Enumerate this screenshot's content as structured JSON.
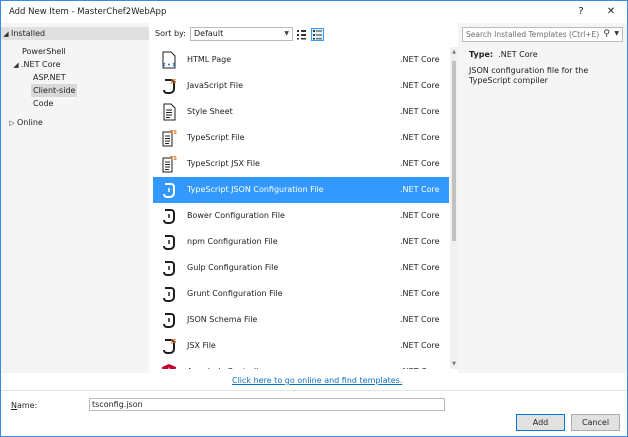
{
  "window": {
    "title": "Add New Item - MasterChef2WebApp",
    "help_label": "?",
    "close_label": "✕"
  },
  "tree": {
    "installed": "Installed",
    "items": [
      {
        "label": "PowerShell"
      },
      {
        "label": ".NET Core"
      },
      {
        "label": "ASP.NET"
      },
      {
        "label": "Client-side"
      },
      {
        "label": "Code"
      }
    ],
    "online": "Online"
  },
  "sort": {
    "label": "Sort by:",
    "value": "Default"
  },
  "templates": [
    {
      "name": "HTML Page",
      "category": ".NET Core",
      "icon": "html-page-icon"
    },
    {
      "name": "JavaScript File",
      "category": ".NET Core",
      "icon": "javascript-file-icon"
    },
    {
      "name": "Style Sheet",
      "category": ".NET Core",
      "icon": "style-sheet-icon"
    },
    {
      "name": "TypeScript File",
      "category": ".NET Core",
      "icon": "typescript-file-icon"
    },
    {
      "name": "TypeScript JSX File",
      "category": ".NET Core",
      "icon": "typescript-jsx-file-icon"
    },
    {
      "name": "TypeScript JSON Configuration File",
      "category": ".NET Core",
      "icon": "json-config-icon",
      "selected": true
    },
    {
      "name": "Bower Configuration File",
      "category": ".NET Core",
      "icon": "json-config-icon"
    },
    {
      "name": "npm Configuration File",
      "category": ".NET Core",
      "icon": "json-config-icon"
    },
    {
      "name": "Gulp Configuration File",
      "category": ".NET Core",
      "icon": "json-config-icon"
    },
    {
      "name": "Grunt Configuration File",
      "category": ".NET Core",
      "icon": "json-config-icon"
    },
    {
      "name": "JSON Schema File",
      "category": ".NET Core",
      "icon": "json-config-icon"
    },
    {
      "name": "JSX File",
      "category": ".NET Core",
      "icon": "jsx-file-icon"
    },
    {
      "name": "AngularJs Controller",
      "category": ".NET Core",
      "icon": "angular-icon"
    }
  ],
  "details": {
    "search_placeholder": "Search Installed Templates (Ctrl+E)",
    "type_label": "Type:",
    "type_value": ".NET Core",
    "description": "JSON configuration file for the TypeScript compiler"
  },
  "online_link": "Click here to go online and find templates.",
  "name_field": {
    "label": "Name:",
    "value": "tsconfig.json"
  },
  "buttons": {
    "add": "Add",
    "cancel": "Cancel"
  },
  "colors": {
    "accent": "#3399ff",
    "link": "#0e70c0",
    "angular": "#c3002f"
  }
}
